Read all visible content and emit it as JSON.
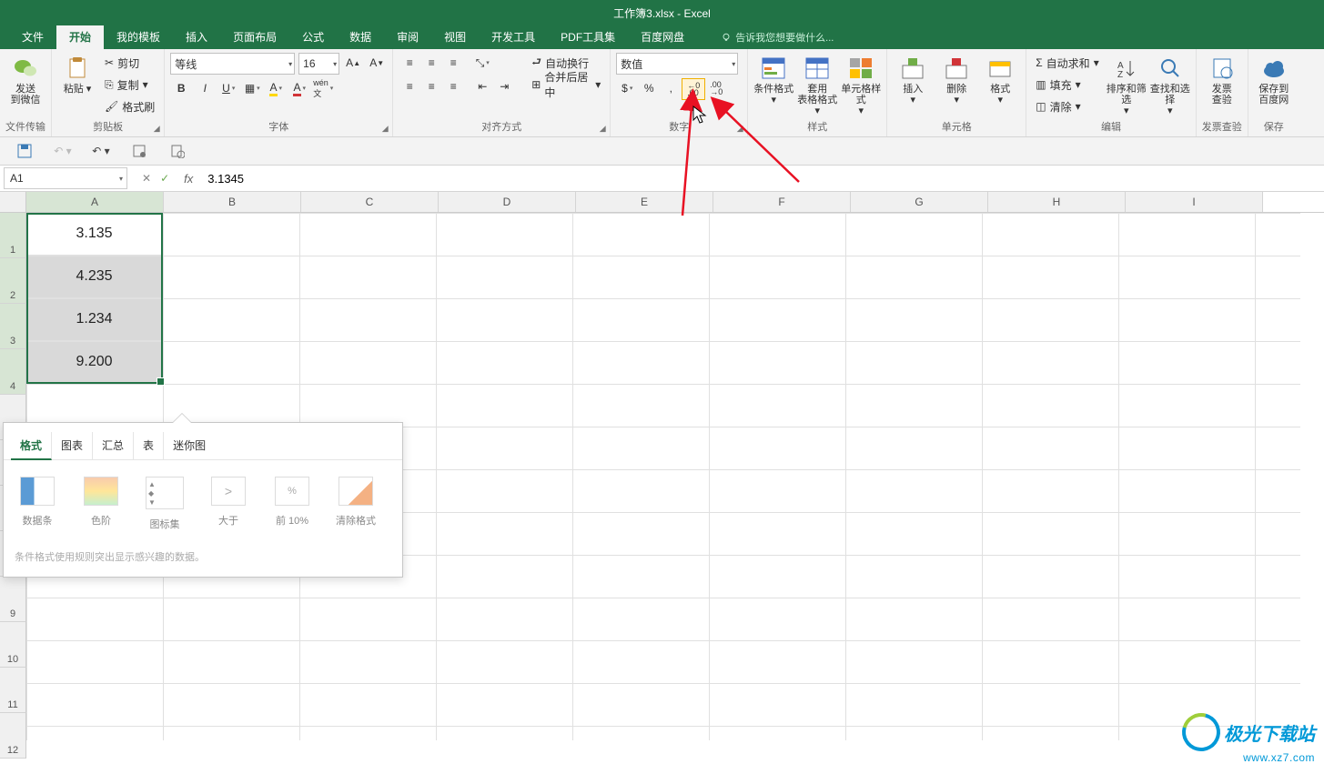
{
  "title": "工作簿3.xlsx - Excel",
  "tabs": {
    "file": "文件",
    "home": "开始",
    "templates": "我的模板",
    "insert": "插入",
    "layout": "页面布局",
    "formula": "公式",
    "data": "数据",
    "review": "审阅",
    "view": "视图",
    "dev": "开发工具",
    "pdf": "PDF工具集",
    "baidu": "百度网盘"
  },
  "tellme": "告诉我您想要做什么...",
  "ribbon": {
    "filetransfer": {
      "label": "文件传输",
      "send": "发送\n到微信"
    },
    "clipboard": {
      "label": "剪贴板",
      "paste": "粘贴",
      "cut": "剪切",
      "copy": "复制",
      "painter": "格式刷"
    },
    "font": {
      "label": "字体",
      "family": "等线",
      "size": "16"
    },
    "align": {
      "label": "对齐方式",
      "wrap": "自动换行",
      "merge": "合并后居中"
    },
    "number": {
      "label": "数字",
      "format": "数值"
    },
    "styles": {
      "label": "样式",
      "cond": "条件格式",
      "table": "套用\n表格格式",
      "cell": "单元格样式"
    },
    "cells": {
      "label": "单元格",
      "insert": "插入",
      "delete": "删除",
      "format": "格式"
    },
    "edit": {
      "label": "编辑",
      "sum": "自动求和",
      "fill": "填充",
      "clear": "清除",
      "sort": "排序和筛选",
      "find": "查找和选择"
    },
    "invoice": {
      "label": "发票查验",
      "btn": "发票\n查验"
    },
    "save": {
      "label": "保存",
      "btn": "保存到\n百度网"
    }
  },
  "namebox": "A1",
  "formula": "3.1345",
  "columns": [
    "A",
    "B",
    "C",
    "D",
    "E",
    "F",
    "G",
    "H",
    "I"
  ],
  "rows": [
    "1",
    "2",
    "3",
    "4",
    "",
    "",
    "",
    "",
    "9",
    "10",
    "11",
    "12"
  ],
  "cellvals": {
    "a1": "3.135",
    "a2": "4.235",
    "a3": "1.234",
    "a4": "9.200"
  },
  "qa": {
    "tabs": {
      "format": "格式",
      "chart": "图表",
      "totals": "汇总",
      "table": "表",
      "spark": "迷你图"
    },
    "items": {
      "databar": "数据条",
      "colorscale": "色阶",
      "iconset": "图标集",
      "gt": "大于",
      "top": "前 10%",
      "clear": "清除格式"
    },
    "hint": "条件格式使用规则突出显示感兴趣的数据。"
  },
  "watermark": {
    "name": "极光下载站",
    "url": "www.xz7.com"
  }
}
